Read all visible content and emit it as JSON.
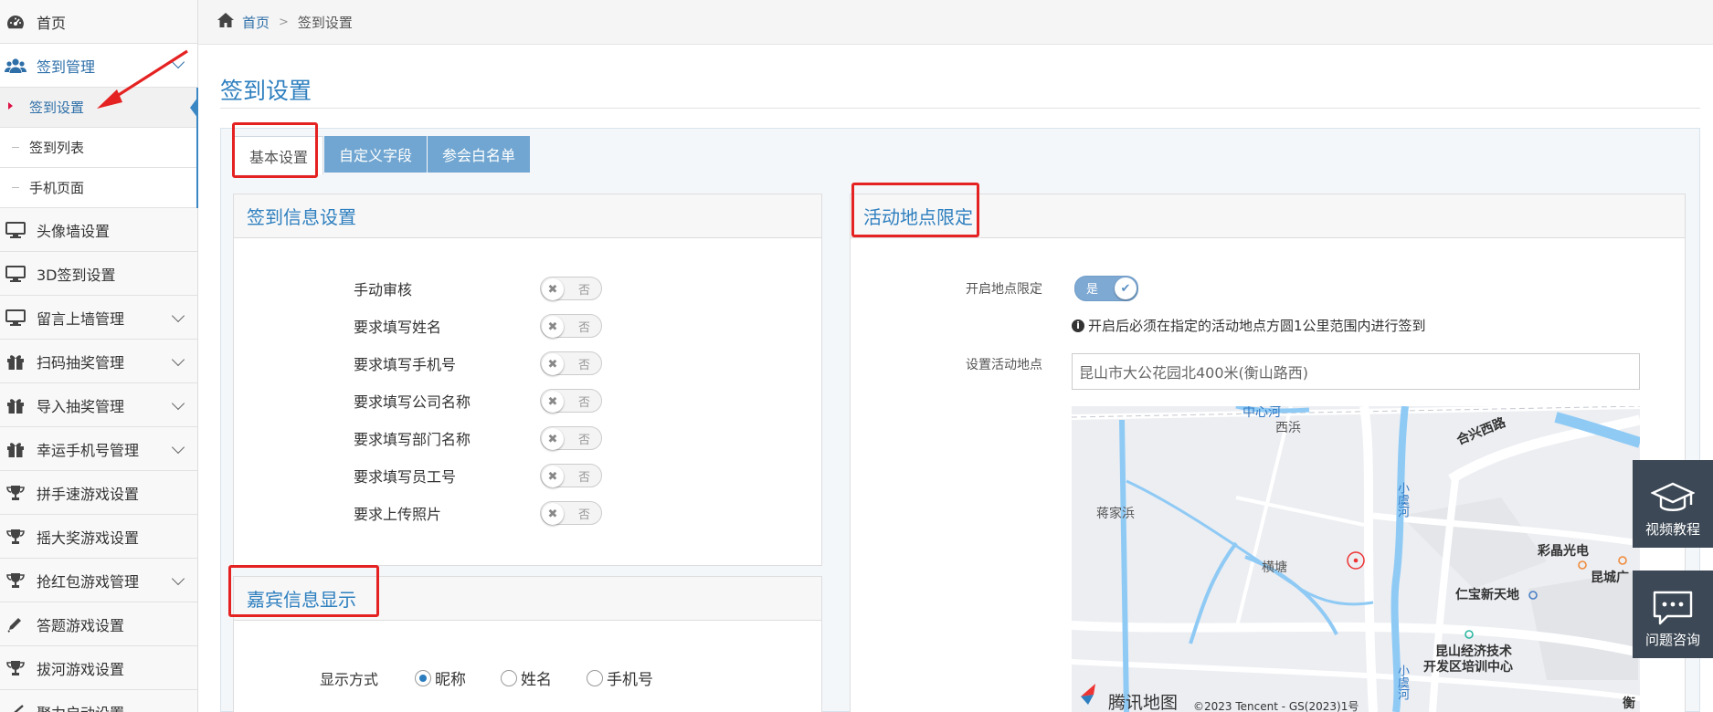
{
  "sidebar": {
    "items": [
      {
        "label": "首页",
        "icon": "dashboard-icon"
      },
      {
        "label": "签到管理",
        "icon": "users-icon",
        "expanded": true,
        "children": [
          {
            "label": "签到设置",
            "active": true
          },
          {
            "label": "签到列表"
          },
          {
            "label": "手机页面"
          }
        ]
      },
      {
        "label": "头像墙设置",
        "icon": "monitor-icon"
      },
      {
        "label": "3D签到设置",
        "icon": "monitor-icon"
      },
      {
        "label": "留言上墙管理",
        "icon": "monitor-icon"
      },
      {
        "label": "扫码抽奖管理",
        "icon": "gift-icon"
      },
      {
        "label": "导入抽奖管理",
        "icon": "gift-icon"
      },
      {
        "label": "幸运手机号管理",
        "icon": "gift-icon"
      },
      {
        "label": "拼手速游戏设置",
        "icon": "trophy-icon"
      },
      {
        "label": "摇大奖游戏设置",
        "icon": "trophy-icon"
      },
      {
        "label": "抢红包游戏管理",
        "icon": "trophy-icon"
      },
      {
        "label": "答题游戏设置",
        "icon": "pencil-icon"
      },
      {
        "label": "拔河游戏设置",
        "icon": "trophy-icon"
      },
      {
        "label": "聚力启动设置",
        "icon": "plane-icon"
      }
    ]
  },
  "breadcrumb": {
    "home": "首页",
    "current": "签到设置"
  },
  "page": {
    "title": "签到设置"
  },
  "tabs": [
    "基本设置",
    "自定义字段",
    "参会白名单"
  ],
  "checkin_panel": {
    "title": "签到信息设置",
    "rows": [
      {
        "label": "手动审核",
        "toggle": "否"
      },
      {
        "label": "要求填写姓名",
        "toggle": "否"
      },
      {
        "label": "要求填写手机号",
        "toggle": "否"
      },
      {
        "label": "要求填写公司名称",
        "toggle": "否"
      },
      {
        "label": "要求填写部门名称",
        "toggle": "否"
      },
      {
        "label": "要求填写员工号",
        "toggle": "否"
      },
      {
        "label": "要求上传照片",
        "toggle": "否"
      }
    ]
  },
  "guest_panel": {
    "title": "嘉宾信息显示",
    "display_label": "显示方式",
    "options": [
      "昵称",
      "姓名",
      "手机号"
    ],
    "selected": "昵称"
  },
  "location_panel": {
    "title": "活动地点限定",
    "enable_label": "开启地点限定",
    "enable_value": "是",
    "hint": "开启后必须在指定的活动地点方圆1公里范围内进行签到",
    "location_label": "设置活动地点",
    "location_value": "昆山市大公花园北400米(衡山路西)"
  },
  "map": {
    "labels": [
      "中心河",
      "西浜",
      "合兴西路",
      "蒋家浜",
      "小虞河",
      "横塘",
      "彩晶光电",
      "昆城广",
      "仁宝新天地",
      "昆山经济技术",
      "开发区培训中心",
      "小虞河",
      "衡"
    ],
    "brand": "腾讯地图",
    "copyright": "©2023 Tencent - GS(2023)1号"
  },
  "float_buttons": [
    "视频教程",
    "问题咨询"
  ],
  "colors": {
    "accent": "#2e7fbf",
    "tab": "#70a6d1",
    "highlight": "#e52222",
    "float": "#3c4855"
  }
}
